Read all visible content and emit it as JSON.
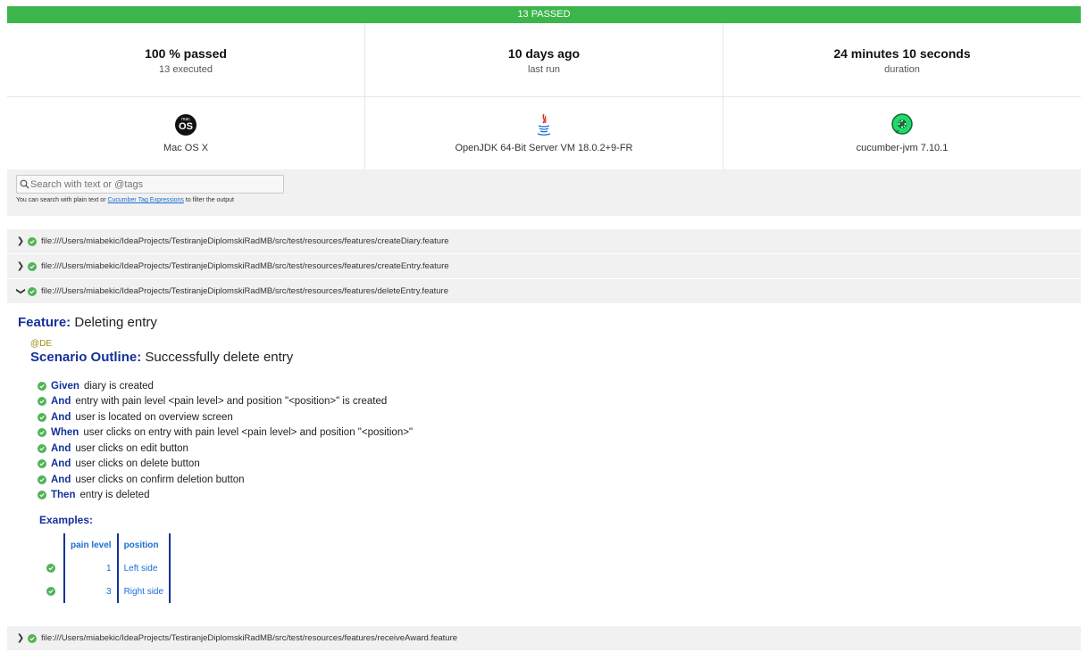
{
  "status_bar": {
    "label": "13 PASSED"
  },
  "stats": [
    {
      "big": "100 % passed",
      "small": "13 executed"
    },
    {
      "big": "10 days ago",
      "small": "last run"
    },
    {
      "big": "24 minutes 10 seconds",
      "small": "duration"
    }
  ],
  "environment": [
    {
      "icon": "macos-icon",
      "label": "Mac OS X",
      "icon_text_top": "mac",
      "icon_text_main": "OS"
    },
    {
      "icon": "java-icon",
      "label": "OpenJDK 64-Bit Server VM 18.0.2+9-FR"
    },
    {
      "icon": "cucumber-icon",
      "label": "cucumber-jvm 7.10.1"
    }
  ],
  "search": {
    "placeholder": "Search with text or @tags",
    "help_prefix": "You can search with plain text or ",
    "help_link": "Cucumber Tag Expressions",
    "help_suffix": " to filter the output"
  },
  "files": [
    {
      "path": "file:///Users/miabekic/IdeaProjects/TestiranjeDiplomskiRadMB/src/test/resources/features/createDiary.feature",
      "expanded": false
    },
    {
      "path": "file:///Users/miabekic/IdeaProjects/TestiranjeDiplomskiRadMB/src/test/resources/features/createEntry.feature",
      "expanded": false
    },
    {
      "path": "file:///Users/miabekic/IdeaProjects/TestiranjeDiplomskiRadMB/src/test/resources/features/deleteEntry.feature",
      "expanded": true
    },
    {
      "path": "file:///Users/miabekic/IdeaProjects/TestiranjeDiplomskiRadMB/src/test/resources/features/receiveAward.feature",
      "expanded": false
    }
  ],
  "feature": {
    "keyword": "Feature:",
    "name": "Deleting entry",
    "tag": "@DE",
    "scenario_keyword": "Scenario Outline:",
    "scenario_name": "Successfully delete entry",
    "steps": [
      {
        "keyword": "Given",
        "text": "diary is created"
      },
      {
        "keyword": "And",
        "text": "entry with pain level <pain level> and position \"<position>\" is created"
      },
      {
        "keyword": "And",
        "text": "user is located on overview screen"
      },
      {
        "keyword": "When",
        "text": "user clicks on entry with pain level <pain level> and position \"<position>\""
      },
      {
        "keyword": "And",
        "text": "user clicks on edit button"
      },
      {
        "keyword": "And",
        "text": "user clicks on delete button"
      },
      {
        "keyword": "And",
        "text": "user clicks on confirm deletion button"
      },
      {
        "keyword": "Then",
        "text": "entry is deleted"
      }
    ],
    "examples_title": "Examples:",
    "examples_headers": [
      "pain level",
      "position"
    ],
    "examples_rows": [
      {
        "pain_level": "1",
        "position": "Left side"
      },
      {
        "pain_level": "3",
        "position": "Right side"
      }
    ]
  },
  "colors": {
    "passed_green": "#3cb54b",
    "keyword_blue": "#15319a",
    "tag_gold": "#a08b10",
    "link_blue": "#1a6fd1"
  }
}
